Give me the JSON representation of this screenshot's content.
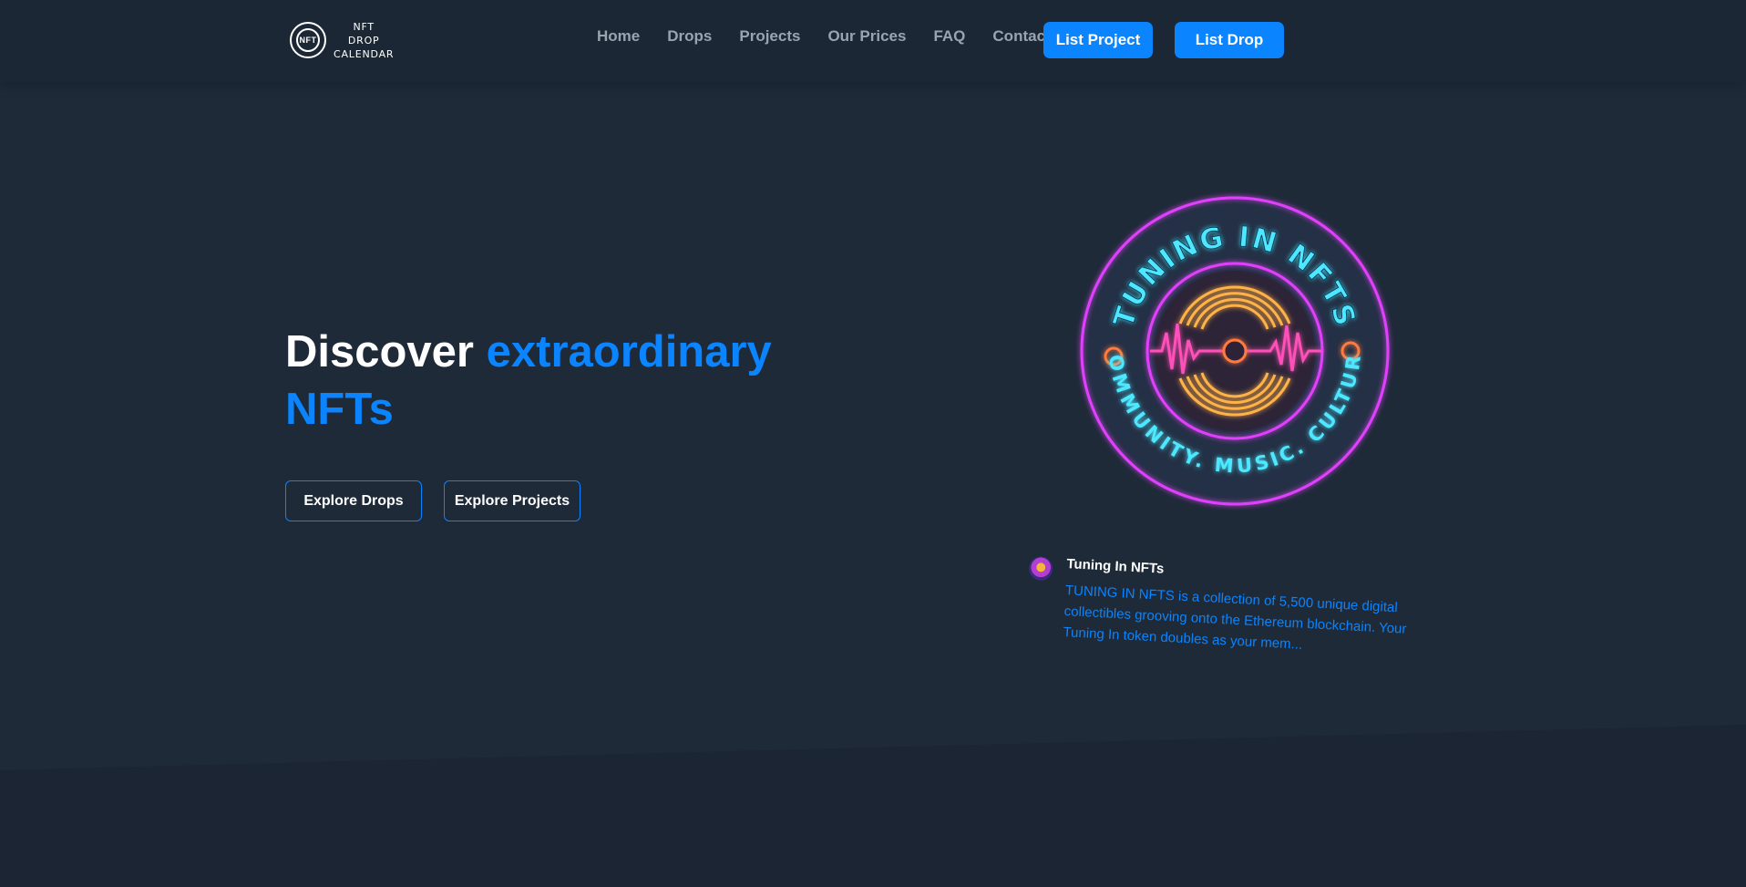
{
  "brand": {
    "mark": "NFT",
    "lines": [
      "NFT",
      "DROP",
      "CALENDAR"
    ]
  },
  "nav": {
    "links": [
      "Home",
      "Drops",
      "Projects",
      "Our Prices",
      "FAQ",
      "Contact"
    ],
    "list_project": "List Project",
    "list_drop": "List Drop"
  },
  "hero": {
    "title_plain": "Discover ",
    "title_accent": "extraordinary NFTs",
    "explore_drops": "Explore Drops",
    "explore_projects": "Explore Projects"
  },
  "featured": {
    "badge_top_text": "TUNING IN NFTS",
    "badge_bottom_text": "COMMUNITY. MUSIC. CULTURE",
    "name": "Tuning In NFTs",
    "description": "TUNING IN NFTS is a collection of 5,500 unique digital collectibles grooving onto the Ethereum blockchain. Your Tuning In token doubles as your mem..."
  },
  "colors": {
    "background": "#1e2a38",
    "nav_background": "#1c2735",
    "accent": "#0a84ff",
    "nav_link": "#9aa4b1",
    "neon_pink": "#e040fb",
    "neon_cyan": "#4de8ff",
    "neon_orange": "#ffb347"
  }
}
